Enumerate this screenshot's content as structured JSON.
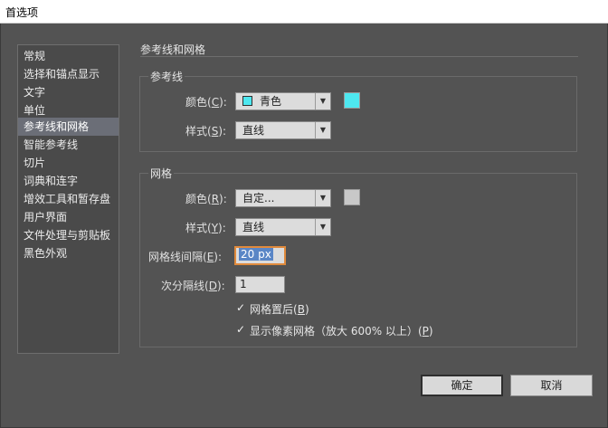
{
  "window": {
    "title": "首选项"
  },
  "sidebar": {
    "items": [
      {
        "label": "常规"
      },
      {
        "label": "选择和锚点显示"
      },
      {
        "label": "文字"
      },
      {
        "label": "单位"
      },
      {
        "label": "参考线和网格"
      },
      {
        "label": "智能参考线"
      },
      {
        "label": "切片"
      },
      {
        "label": "词典和连字"
      },
      {
        "label": "增效工具和暂存盘"
      },
      {
        "label": "用户界面"
      },
      {
        "label": "文件处理与剪贴板"
      },
      {
        "label": "黑色外观"
      }
    ],
    "selected_index": 4
  },
  "panel": {
    "title": "参考线和网格",
    "guides": {
      "group_title": "参考线",
      "color_label": "颜色",
      "color_key": "C",
      "color_value": "青色",
      "color_hex": "#4ee8f0",
      "style_label": "样式",
      "style_key": "S",
      "style_value": "直线"
    },
    "grid": {
      "group_title": "网格",
      "color_label": "颜色",
      "color_key": "R",
      "color_value": "自定...",
      "color_hex": "#c8c8c8",
      "style_label": "样式",
      "style_key": "Y",
      "style_value": "直线",
      "spacing_label": "网格线间隔",
      "spacing_key": "E",
      "spacing_value": "20 px",
      "subdiv_label": "次分隔线",
      "subdiv_key": "D",
      "subdiv_value": "1",
      "behind_label": "网格置后",
      "behind_key": "B",
      "behind_checked": true,
      "pixel_grid_label": "显示像素网格（放大 600% 以上）",
      "pixel_grid_key": "P",
      "pixel_grid_checked": true
    }
  },
  "buttons": {
    "ok": "确定",
    "cancel": "取消"
  },
  "icons": {
    "check": "✓",
    "dropdown": "▼"
  }
}
